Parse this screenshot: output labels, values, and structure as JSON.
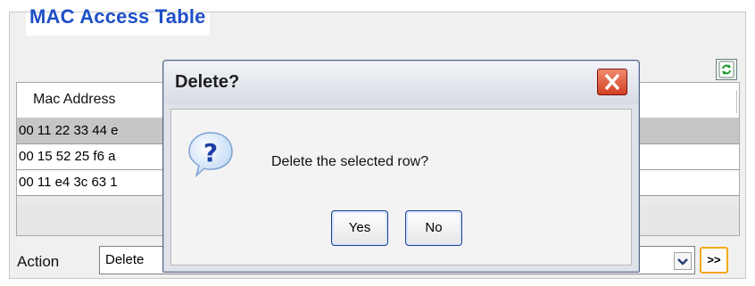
{
  "panel": {
    "title": "MAC Access Table"
  },
  "table": {
    "columns": [
      "Mac Address"
    ],
    "rows": [
      {
        "mac": "00 11 22 33 44 e",
        "selected": true
      },
      {
        "mac": "00 15 52 25 f6 a",
        "selected": false
      },
      {
        "mac": "00 11 e4 3c 63 1",
        "selected": false
      }
    ]
  },
  "actions": {
    "label": "Action",
    "selected": "Delete",
    "go_label": ">>"
  },
  "dialog": {
    "title": "Delete?",
    "message": "Delete the selected row?",
    "yes_label": "Yes",
    "no_label": "No"
  },
  "icons": {
    "refresh": "refresh-icon",
    "question": "question-icon",
    "close": "close-icon",
    "dropdown": "chevron-down-icon"
  },
  "colors": {
    "title": "#1e4fc8",
    "selected_row": "#c6c6c6",
    "close_button": "#d24022",
    "go_button_border": "#f4a91a"
  }
}
